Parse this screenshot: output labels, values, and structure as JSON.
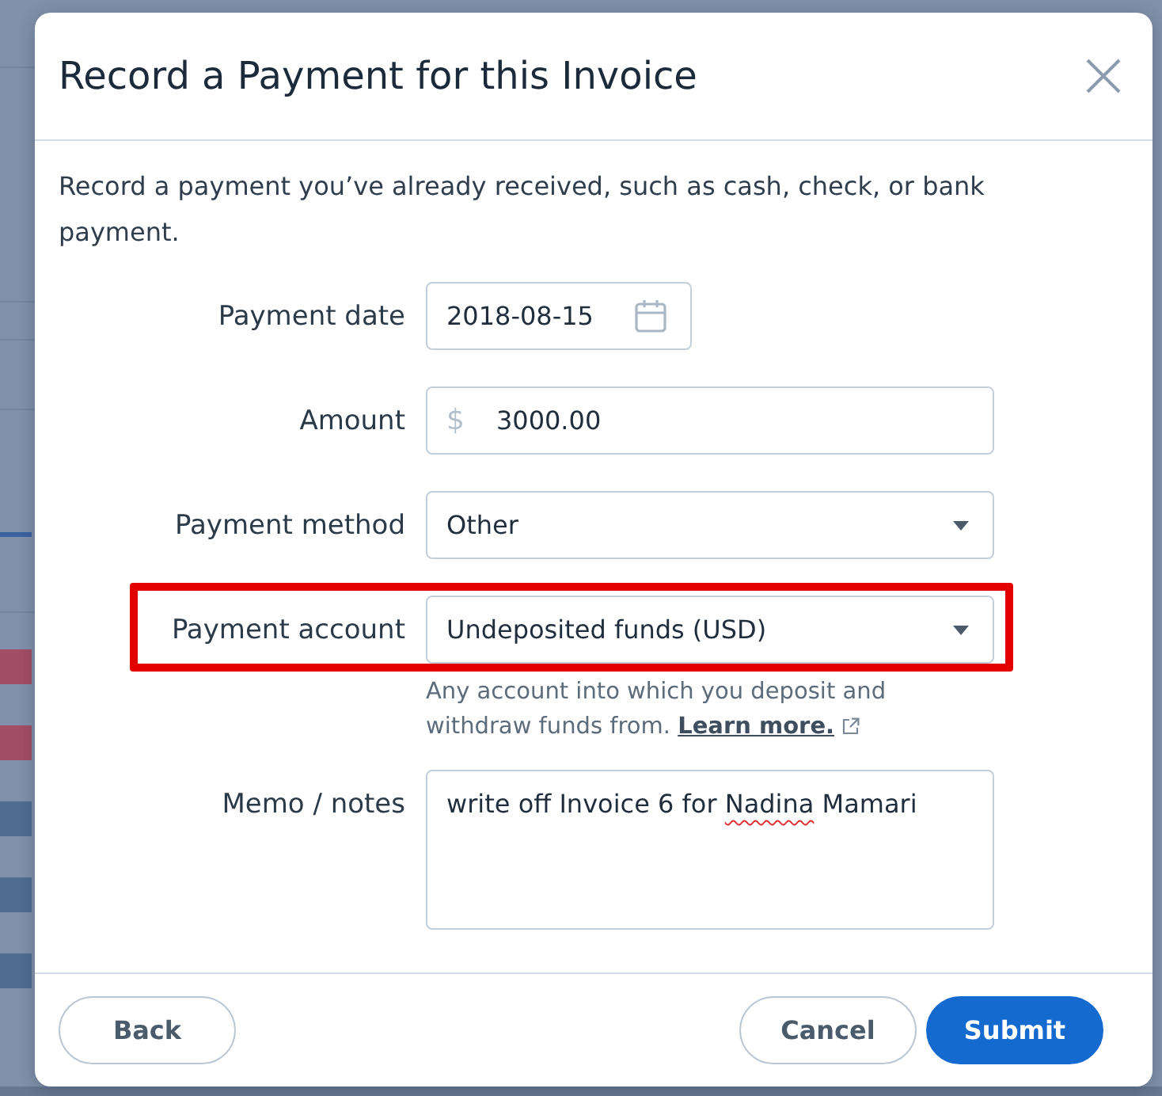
{
  "dialog": {
    "title": "Record a Payment for this Invoice",
    "description": "Record a payment you’ve already received, such as cash, check, or bank payment."
  },
  "fields": [
    {
      "kind": "date",
      "label": "Payment date",
      "value": "2018-08-15",
      "highlighted": false
    },
    {
      "kind": "currency",
      "label": "Amount",
      "prefix": "$",
      "value": "3000.00",
      "highlighted": false
    },
    {
      "kind": "select",
      "label": "Payment method",
      "value": "Other",
      "highlighted": false
    },
    {
      "kind": "select",
      "label": "Payment account",
      "value": "Undeposited funds (USD)",
      "highlighted": true,
      "help": "Any account into which you deposit and withdraw funds from.",
      "help_link": "Learn more."
    },
    {
      "kind": "textarea",
      "label": "Memo / notes",
      "segments": [
        {
          "text": "write off Invoice 6 for ",
          "misspelled": false
        },
        {
          "text": "Nadina",
          "misspelled": true
        },
        {
          "text": " Mamari",
          "misspelled": false
        }
      ],
      "highlighted": false
    }
  ],
  "footer": {
    "start_buttons": [
      {
        "label": "Back",
        "kind": "secondary"
      }
    ],
    "end_buttons": [
      {
        "label": "Cancel",
        "kind": "secondary"
      },
      {
        "label": "Submit",
        "kind": "primary"
      }
    ]
  },
  "backdrop": {
    "tags": [
      {
        "color": "#a24e67"
      },
      {
        "color": "#a24e67"
      },
      {
        "color": "#4e6d91"
      },
      {
        "color": "#4e6d91"
      },
      {
        "color": "#4e6d91"
      }
    ]
  }
}
